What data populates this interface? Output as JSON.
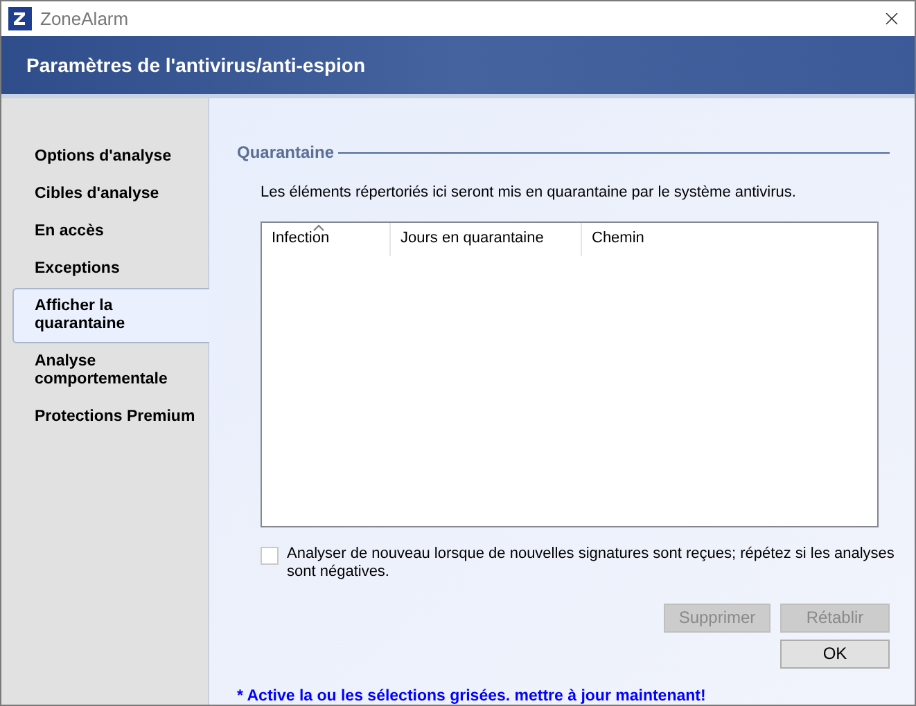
{
  "window": {
    "title": "ZoneAlarm"
  },
  "header": {
    "title": "Paramètres de l'antivirus/anti-espion"
  },
  "sidebar": {
    "items": [
      {
        "label": "Options d'analyse",
        "selected": false
      },
      {
        "label": "Cibles d'analyse",
        "selected": false
      },
      {
        "label": "En accès",
        "selected": false
      },
      {
        "label": "Exceptions",
        "selected": false
      },
      {
        "label": "Afficher la quarantaine",
        "selected": true
      },
      {
        "label": "Analyse comportementale",
        "selected": false
      },
      {
        "label": "Protections Premium",
        "selected": false
      }
    ]
  },
  "section": {
    "title": "Quarantaine",
    "description": "Les éléments répertoriés ici seront mis en quarantaine par le système antivirus."
  },
  "table": {
    "columns": [
      {
        "label": "Infection",
        "sorted": true
      },
      {
        "label": "Jours en quarantaine",
        "sorted": false
      },
      {
        "label": "Chemin",
        "sorted": false
      }
    ]
  },
  "rescan_option": {
    "label": "Analyser de nouveau lorsque de nouvelles signatures sont reçues; répétez si les analyses sont négatives.",
    "checked": false
  },
  "buttons": [
    {
      "label": "Supprimer",
      "disabled": true
    },
    {
      "label": "Rétablir",
      "disabled": true
    },
    {
      "label": "OK",
      "disabled": false
    }
  ],
  "footer_note": "* Active la ou les sélections grisées. mettre à jour maintenant!"
}
